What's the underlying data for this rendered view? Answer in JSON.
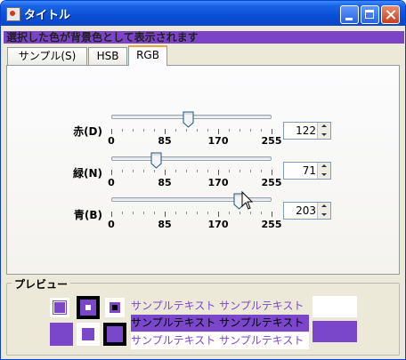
{
  "window": {
    "title": "タイトル"
  },
  "banner": {
    "text": "選択した色が背景色として表示されます"
  },
  "tabs": [
    {
      "label": "サンプル(S)",
      "selected": false
    },
    {
      "label": "HSB",
      "selected": false
    },
    {
      "label": "RGB",
      "selected": true
    }
  ],
  "sliders": [
    {
      "label": "赤(D)",
      "value": 122,
      "spin_text": "122"
    },
    {
      "label": "緑(N)",
      "value": 71,
      "spin_text": "71"
    },
    {
      "label": "青(B)",
      "value": 203,
      "spin_text": "203"
    }
  ],
  "slider_scale": {
    "min": 0,
    "max": 255,
    "tick_labels": [
      "0",
      "85",
      "170",
      "255"
    ]
  },
  "preview": {
    "legend": "プレビュー",
    "sample_text_1": "サンプルテキスト サンプルテキスト",
    "sample_text_2": "サンプルテキスト サンプルテキスト",
    "sample_text_3": "サンプルテキスト サンプルテキスト"
  },
  "colors": {
    "selected": "#7a47cb",
    "title_bar": "#0a4fd5"
  },
  "icons": [
    "app-icon",
    "minimize-icon",
    "maximize-icon",
    "close-icon",
    "mouse-cursor-icon"
  ]
}
